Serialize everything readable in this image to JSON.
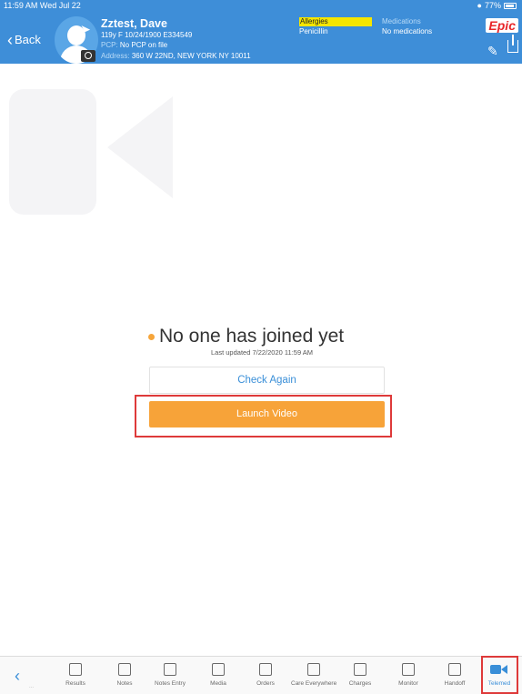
{
  "status_bar": {
    "time": "11:59 AM  Wed Jul 22",
    "battery": "77%"
  },
  "header": {
    "back_label": "Back",
    "patient_name": "Zztest, Dave",
    "demographics": "119y F  10/24/1900  E334549",
    "pcp_label": "PCP:",
    "pcp_value": "No PCP on file",
    "address_label": "Address:",
    "address_value": "360 W 22ND, NEW YORK NY 10011",
    "allergies_label": "Allergies",
    "allergies_value": "Penicillin",
    "medications_label": "Medications",
    "medications_value": "No medications",
    "logo_text": "Epic"
  },
  "main": {
    "status_text": "No one has joined yet",
    "last_updated": "Last updated 7/22/2020 11:59 AM",
    "check_again_label": "Check Again",
    "launch_video_label": "Launch Video"
  },
  "tabbar": {
    "faded_label": "...",
    "tabs": [
      {
        "label": "Results",
        "icon": "results-icon"
      },
      {
        "label": "Notes",
        "icon": "notes-icon"
      },
      {
        "label": "Notes Entry",
        "icon": "notes-entry-icon"
      },
      {
        "label": "Media",
        "icon": "media-icon"
      },
      {
        "label": "Orders",
        "icon": "orders-icon"
      },
      {
        "label": "Care Everywhere",
        "icon": "care-everywhere-icon"
      },
      {
        "label": "Charges",
        "icon": "charges-icon"
      },
      {
        "label": "Monitor",
        "icon": "monitor-icon"
      },
      {
        "label": "Handoff",
        "icon": "handoff-icon"
      },
      {
        "label": "Telemed",
        "icon": "video-camera-icon",
        "active": true
      }
    ]
  },
  "colors": {
    "header_bg": "#3e8ed8",
    "accent": "#3a8fd8",
    "launch_button": "#f7a339",
    "highlight": "#de3a3a",
    "allergy_bg": "#f5e600"
  }
}
